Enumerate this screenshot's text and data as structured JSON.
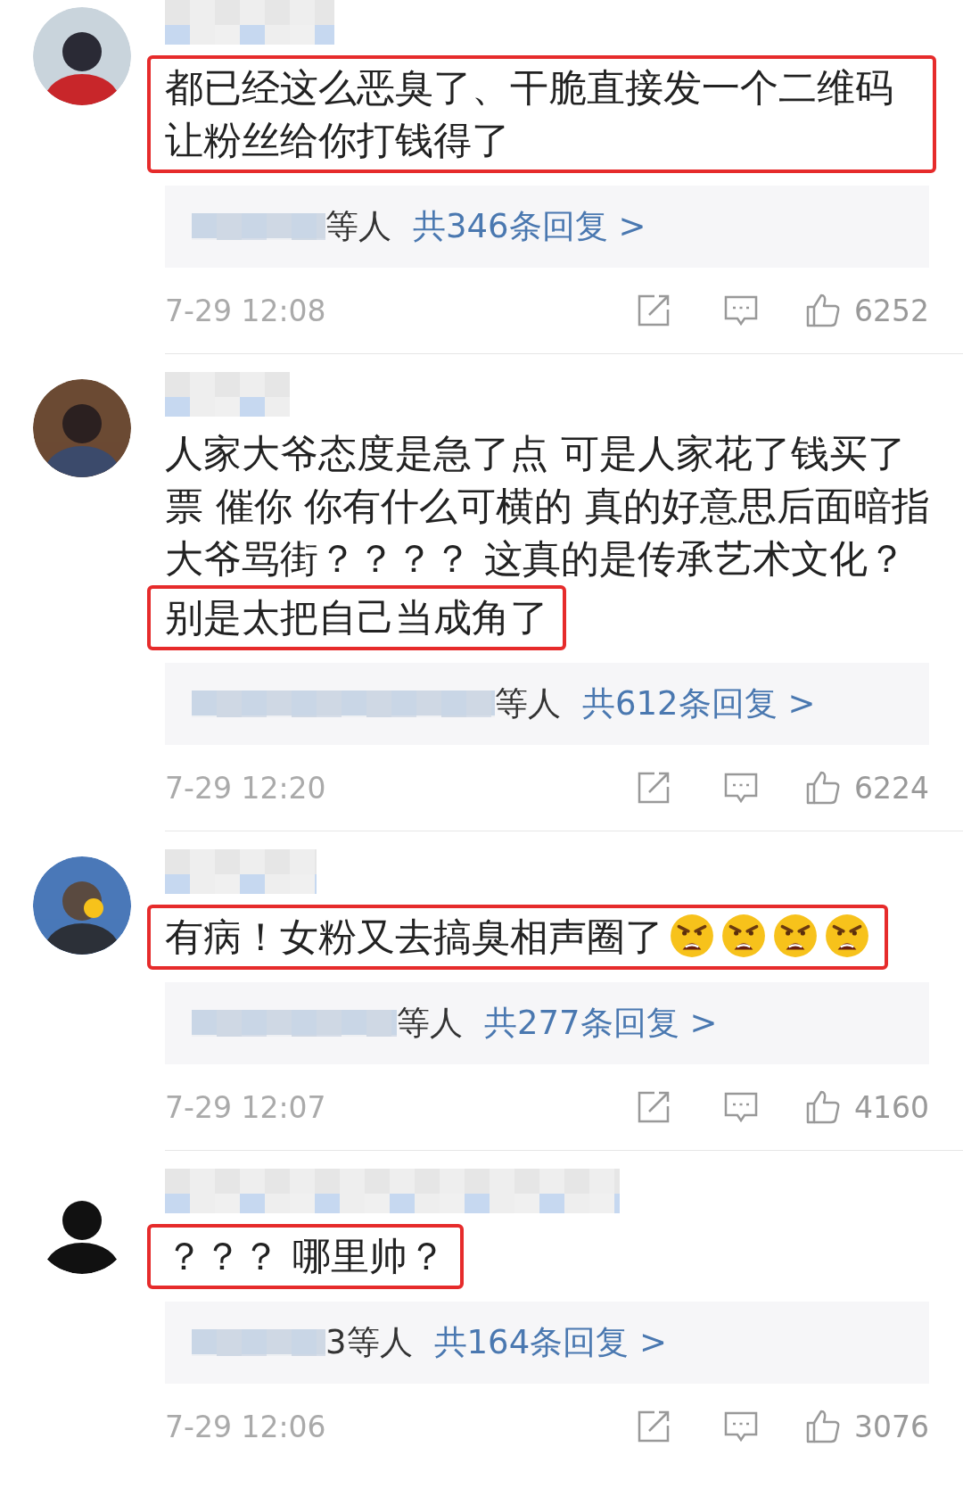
{
  "comments": [
    {
      "segments": [
        {
          "text": "都已经这么恶臭了、干脆直接发一个二维码让粉丝给你打钱得了",
          "highlighted": true
        }
      ],
      "reply_users": "等人",
      "reply_link": "共346条回复 >",
      "time": "7-29 12:08",
      "likes": "6252"
    },
    {
      "segments": [
        {
          "text": "人家大爷态度是急了点 可是人家花了钱买了票 催你 你有什么可横的 真的好意思后面暗指大爷骂街？？？？ 这真的是传承艺术文化？",
          "highlighted": false
        },
        {
          "text": "别是太把自己当成角了",
          "highlighted": true
        }
      ],
      "reply_users": "等人",
      "reply_link": "共612条回复 >",
      "time": "7-29 12:20",
      "likes": "6224"
    },
    {
      "segments": [
        {
          "text": "有病！女粉又去搞臭相声圈了",
          "highlighted": true,
          "emojis": [
            {
              "kind": "angry"
            },
            {
              "kind": "angry"
            },
            {
              "kind": "angry"
            },
            {
              "kind": "angry"
            }
          ]
        }
      ],
      "reply_users": "等人",
      "reply_link": "共277条回复 >",
      "time": "7-29 12:07",
      "likes": "4160"
    },
    {
      "segments": [
        {
          "text": "？？？ 哪里帅？",
          "highlighted": true
        }
      ],
      "reply_users": "3等人",
      "reply_link": "共164条回复 >",
      "time": "7-29 12:06",
      "likes": "3076"
    }
  ]
}
